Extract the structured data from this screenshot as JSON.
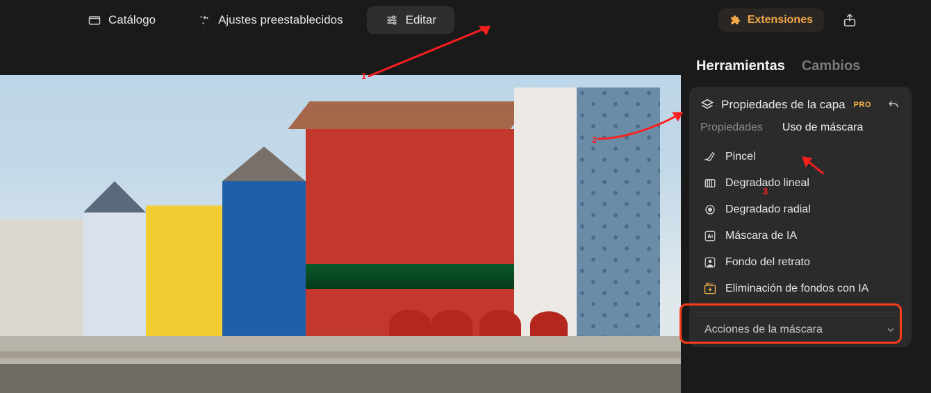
{
  "topbar": {
    "catalog": "Catálogo",
    "presets": "Ajustes preestablecidos",
    "edit": "Editar",
    "extensions": "Extensiones"
  },
  "side": {
    "tab_tools": "Herramientas",
    "tab_changes": "Cambios"
  },
  "panel": {
    "title": "Propiedades de la capa",
    "pro": "PRO",
    "subtabs": {
      "properties": "Propiedades",
      "mask_use": "Uso de máscara"
    },
    "tools": [
      {
        "id": "brush",
        "label": "Pincel"
      },
      {
        "id": "linear",
        "label": "Degradado lineal"
      },
      {
        "id": "radial",
        "label": "Degradado radial"
      },
      {
        "id": "aimask",
        "label": "Máscara de IA"
      },
      {
        "id": "portraitbg",
        "label": "Fondo del retrato"
      },
      {
        "id": "bgremove",
        "label": "Eliminación de fondos con IA"
      }
    ],
    "actions": "Acciones de la máscara"
  },
  "annotations": {
    "a1": "1",
    "a2": "2",
    "a3": "3"
  }
}
